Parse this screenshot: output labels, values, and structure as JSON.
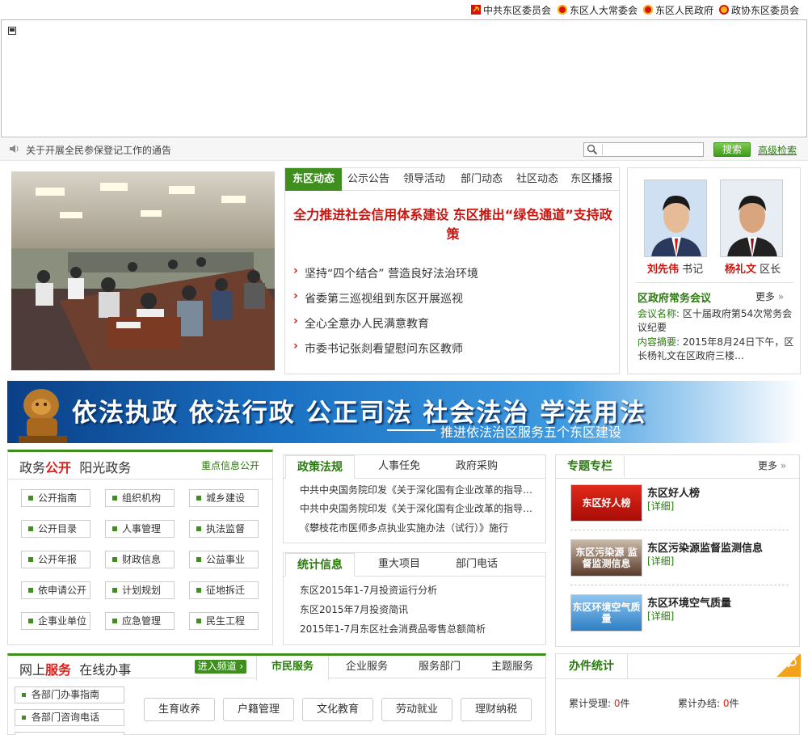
{
  "top_links": [
    {
      "label": "中共东区委员会",
      "icon": "party-emblem-icon",
      "color": "#d8140a"
    },
    {
      "label": "东区人大常委会",
      "icon": "national-emblem-icon",
      "color": "#d8140a"
    },
    {
      "label": "东区人民政府",
      "icon": "national-emblem-icon",
      "color": "#d8140a"
    },
    {
      "label": "政协东区委员会",
      "icon": "cppcc-emblem-icon",
      "color": "#e8a50c"
    }
  ],
  "notice": {
    "text": "关于开展全民参保登记工作的通告"
  },
  "search": {
    "placeholder": "",
    "button": "搜索",
    "advanced": "高级检索"
  },
  "news": {
    "tabs": [
      "东区动态",
      "公示公告",
      "领导活动",
      "部门动态",
      "社区动态",
      "东区播报"
    ],
    "headline": "全力推进社会信用体系建设 东区推出“绿色通道”支持政策",
    "items": [
      "坚持“四个结合” 营造良好法治环境",
      "省委第三巡视组到东区开展巡视",
      "全心全意办人民满意教育",
      "市委书记张剡看望慰问东区教师"
    ]
  },
  "leaders": [
    {
      "name": "刘先伟",
      "title": "书记"
    },
    {
      "name": "杨礼文",
      "title": "区长"
    }
  ],
  "meeting": {
    "title": "区政府常务会议",
    "more": "更多",
    "name_label": "会议名称:",
    "name": "区十届政府第54次常务会议纪要",
    "summary_label": "内容摘要:",
    "summary": "2015年8月24日下午，区长杨礼文在区政府三楼…"
  },
  "slogan": {
    "main": "依法执政 依法行政 公正司法 社会法治 学法用法",
    "sub": "推进依法治区服务五个东区建设"
  },
  "govopen": {
    "title_a": "政务",
    "title_b": "公开",
    "title_c": "阳光政务",
    "link": "重点信息公开",
    "items": [
      "公开指南",
      "组织机构",
      "城乡建设",
      "公开目录",
      "人事管理",
      "执法监督",
      "公开年报",
      "财政信息",
      "公益事业",
      "依申请公开",
      "计划规划",
      "征地拆迁",
      "企事业单位",
      "应急管理",
      "民生工程"
    ]
  },
  "policy": {
    "tabs": [
      "政策法规",
      "人事任免",
      "政府采购"
    ],
    "items": [
      "中共中央国务院印发《关于深化国有企业改革的指导…",
      "中共中央国务院印发《关于深化国有企业改革的指导…",
      "《攀枝花市医师多点执业实施办法（试行）》施行"
    ]
  },
  "stats_info": {
    "tabs": [
      "统计信息",
      "重大项目",
      "部门电话"
    ],
    "items": [
      "东区2015年1-7月投资运行分析",
      "东区2015年7月投资简讯",
      "2015年1-7月东区社会消费品零售总额简析"
    ]
  },
  "topics": {
    "title": "专题专栏",
    "more": "更多",
    "items": [
      {
        "title": "东区好人榜",
        "detail": "[详细]",
        "thumb": "东区好人榜",
        "color": "#c81610"
      },
      {
        "title": "东区污染源监督监测信息",
        "detail": "[详细]",
        "thumb": "东区污染源 监督监测信息",
        "color": "#6b4a3a"
      },
      {
        "title": "东区环境空气质量",
        "detail": "[详细]",
        "thumb": "东区环境空气质量",
        "color": "#2f7fc4"
      }
    ]
  },
  "service": {
    "title_a": "网上",
    "title_b": "服务",
    "title_c": "在线办事",
    "enter": "进入频道",
    "tabs": [
      "市民服务",
      "企业服务",
      "服务部门",
      "主题服务"
    ],
    "side_items": [
      "各部门办事指南",
      "各部门咨询电话"
    ],
    "buttons": [
      "生育收养",
      "户籍管理",
      "文化教育",
      "劳动就业",
      "理财纳税"
    ]
  },
  "work_stats": {
    "title": "办件统计",
    "accepted_label": "累计受理:",
    "accepted": "0",
    "done_label": "累计办结:",
    "done": "0",
    "unit": "件"
  }
}
